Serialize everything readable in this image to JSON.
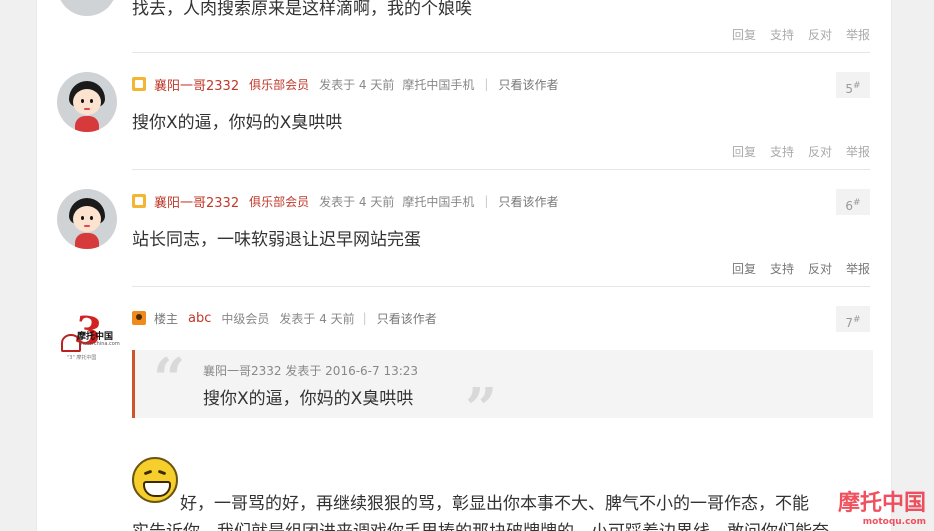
{
  "prev_post": {
    "content": "找去，人肉搜索原来是这样滴啊，我的个娘唉",
    "actions": [
      "回复",
      "支持",
      "反对",
      "举报"
    ]
  },
  "posts": [
    {
      "user": "襄阳一哥2332",
      "rank": "俱乐部会员",
      "posted": "发表于 4 天前",
      "device": "摩托中国手机",
      "only_author": "只看该作者",
      "floor": "5",
      "content": "搜你X的逼，你妈的X臭哄哄",
      "actions": [
        "回复",
        "支持",
        "反对",
        "举报"
      ]
    },
    {
      "user": "襄阳一哥2332",
      "rank": "俱乐部会员",
      "posted": "发表于 4 天前",
      "device": "摩托中国手机",
      "only_author": "只看该作者",
      "floor": "6",
      "content": "站长同志，一味软弱退让迟早网站完蛋",
      "actions": [
        "回复",
        "支持",
        "反对",
        "举报"
      ]
    },
    {
      "louzhu": "楼主",
      "user": "abc",
      "rank": "中级会员",
      "posted": "发表于 4 天前",
      "only_author": "只看该作者",
      "floor": "7",
      "quote_meta": "襄阳一哥2332 发表于 2016-6-7 13:23",
      "quote_text": "搜你X的逼，你妈的X臭哄哄",
      "reply_line1": "好，一哥骂的好，再继续狠狠的骂，彰显出你本事不大、脾气不小的一哥作态，不能",
      "reply_line2": "实告诉你，我们就是组团进来调戏你手里捧的那块破牌牌的，小可踩着边界线，敢问你们能奈"
    }
  ],
  "logo_avatar": {
    "number": "3",
    "brand": "摩托中国",
    "site": "motorchina.com",
    "tag": "\"3\" 摩托中国"
  },
  "watermark": {
    "text": "摩托中国",
    "site": "motoqu.com"
  },
  "colors": {
    "accent": "#c0392b",
    "quote_border": "#d0542a"
  }
}
